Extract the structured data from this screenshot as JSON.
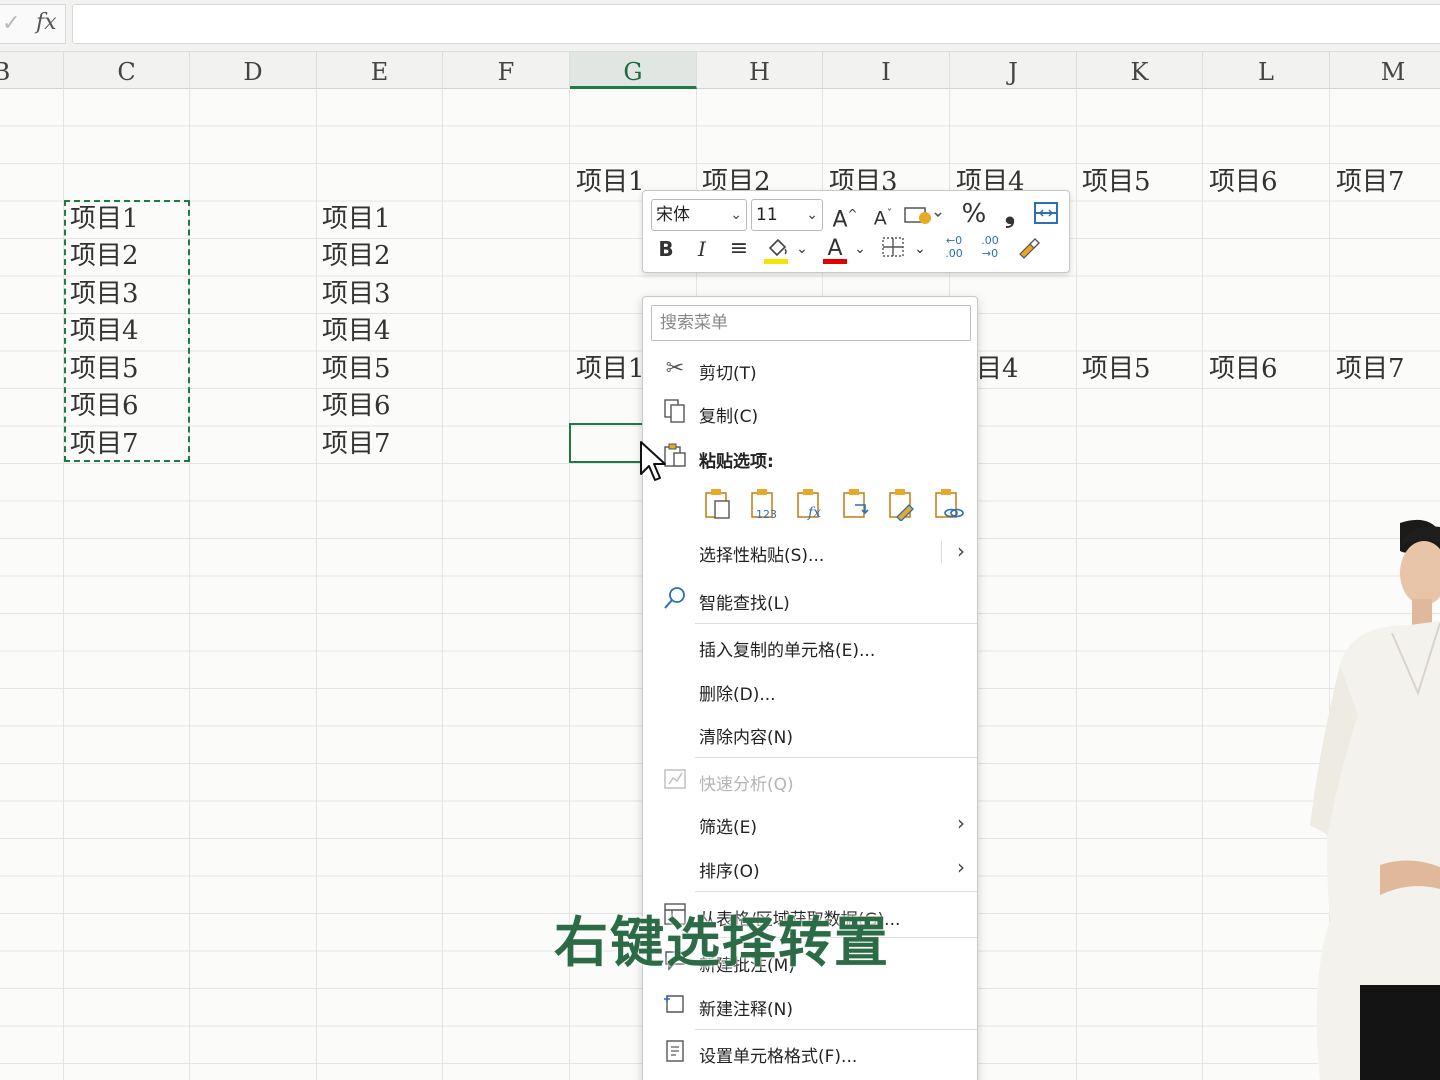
{
  "formula_bar": {
    "check_glyph": "✓",
    "fx_label": "fx",
    "value": ""
  },
  "columns": [
    "B",
    "C",
    "D",
    "E",
    "F",
    "G",
    "H",
    "I",
    "J",
    "K",
    "L",
    "M"
  ],
  "active_column": "G",
  "source_list": [
    "项目1",
    "项目2",
    "项目3",
    "项目4",
    "项目5",
    "项目6",
    "项目7"
  ],
  "copy_list": [
    "项目1",
    "项目2",
    "项目3",
    "项目4",
    "项目5",
    "项目6",
    "项目7"
  ],
  "row1_items": [
    "项目1",
    "项目2",
    "项目3",
    "项目4",
    "项目5",
    "项目6",
    "项目7"
  ],
  "row2_items": [
    "项目1",
    "",
    "",
    "目4",
    "项目5",
    "项目6",
    "项目7"
  ],
  "mini_toolbar": {
    "font_name": "宋体",
    "font_size": "11",
    "increase_font": "A",
    "decrease_font": "A",
    "percent": "%",
    "comma": "❟",
    "bold": "B",
    "italic": "I",
    "font_color_letter": "A",
    "fill_color": "#f2e600",
    "font_color": "#e00000",
    "inc_decimal": "←0 .00",
    "dec_decimal": ".00 →0"
  },
  "context_menu": {
    "search_placeholder": "搜索菜单",
    "items": {
      "cut": "剪切(T)",
      "copy": "复制(C)",
      "paste_options": "粘贴选项:",
      "paste_special": "选择性粘贴(S)...",
      "smart_lookup": "智能查找(L)",
      "insert_copied": "插入复制的单元格(E)...",
      "delete": "删除(D)...",
      "clear": "清除内容(N)",
      "quick_analysis": "快速分析(Q)",
      "filter": "筛选(E)",
      "sort": "排序(O)",
      "get_data": "从表格/区域获取数据(G)...",
      "new_comment": "新建批注(M)",
      "new_note": "新建注释(N)",
      "format_cells": "设置单元格格式(F)..."
    },
    "paste_icons": [
      "paste-icon",
      "paste-values-icon",
      "paste-formulas-icon",
      "paste-transpose-icon",
      "paste-formatting-icon",
      "paste-link-icon"
    ]
  },
  "caption": "右键选择转置"
}
